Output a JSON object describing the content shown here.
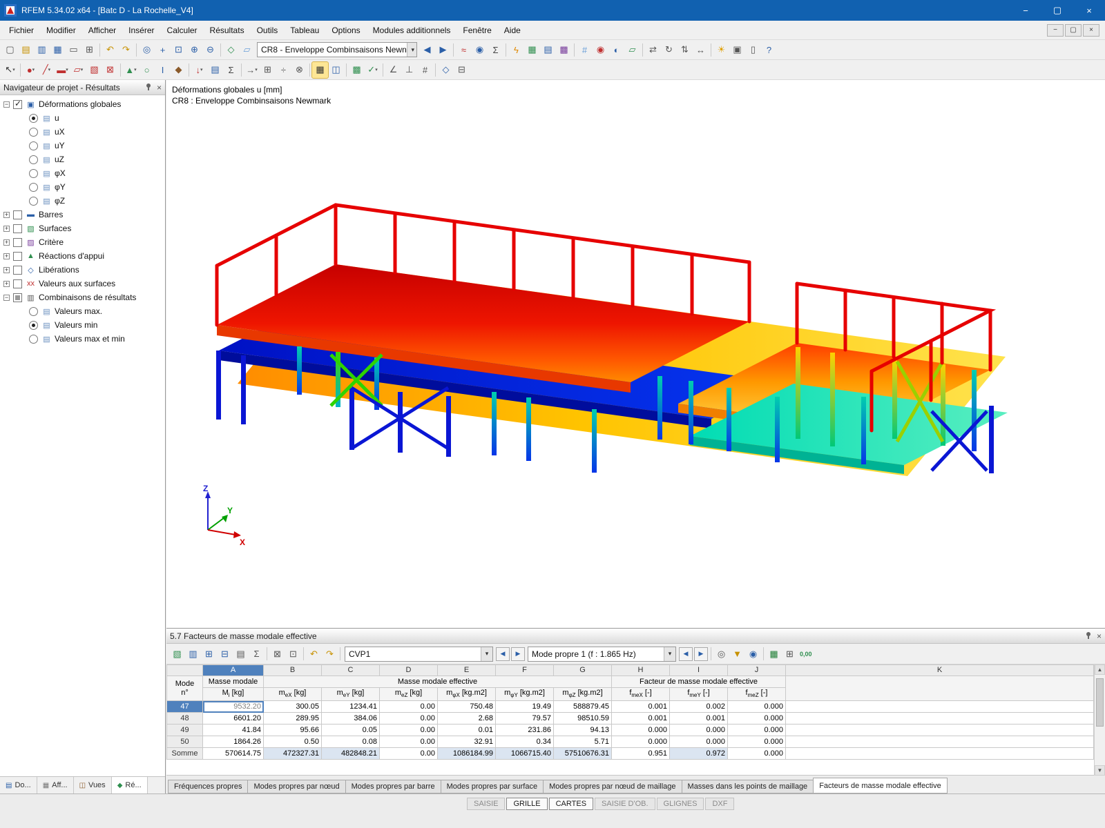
{
  "glyphs": {
    "chevron": "▾",
    "prev": "◀",
    "next": "▶",
    "close": "×"
  },
  "window": {
    "title": "RFEM 5.34.02 x64 - [Batc D - La Rochelle_V4]",
    "controls": {
      "minimize": "−",
      "maximize": "▢",
      "close": "×"
    },
    "mdi": {
      "minimize": "−",
      "restore": "▢",
      "close": "×"
    }
  },
  "menu": {
    "items": [
      "Fichier",
      "Modifier",
      "Afficher",
      "Insérer",
      "Calculer",
      "Résultats",
      "Outils",
      "Tableau",
      "Options",
      "Modules additionnels",
      "Fenêtre",
      "Aide"
    ]
  },
  "toolbars": {
    "case_combo": "CR8 - Enveloppe Combinsaisons Newn",
    "row1_left": [
      {
        "n": "new",
        "g": "▢",
        "c": "#555555"
      },
      {
        "n": "open",
        "g": "▤",
        "c": "#c79100"
      },
      {
        "n": "save",
        "g": "▥",
        "c": "#2b5fa8"
      },
      {
        "n": "save-all",
        "g": "▦",
        "c": "#2b5fa8"
      },
      {
        "n": "print",
        "g": "▭",
        "c": "#555555"
      },
      {
        "n": "copy",
        "g": "⊞",
        "c": "#555555"
      },
      {
        "sep": true
      },
      {
        "n": "undo",
        "g": "↶",
        "c": "#c79100"
      },
      {
        "n": "redo",
        "g": "↷",
        "c": "#c79100"
      },
      {
        "sep": true
      },
      {
        "n": "zoom",
        "g": "◎",
        "c": "#2b5fa8"
      },
      {
        "n": "pan",
        "g": "+",
        "c": "#2b5fa8"
      },
      {
        "n": "zoom-window",
        "g": "⊡",
        "c": "#2b5fa8"
      },
      {
        "n": "zoom-in",
        "g": "⊕",
        "c": "#2b5fa8"
      },
      {
        "n": "zoom-out",
        "g": "⊖",
        "c": "#2b5fa8"
      },
      {
        "sep": true
      },
      {
        "n": "isometric-view",
        "g": "◇",
        "c": "#2f8f4f"
      },
      {
        "n": "wireframe-view",
        "g": "▱",
        "c": "#6a9fd8"
      }
    ],
    "row1_right": [
      {
        "n": "previous-loadcase",
        "g": "◀",
        "c": "#2b5fa8"
      },
      {
        "n": "next-loadcase",
        "g": "▶",
        "c": "#2b5fa8"
      },
      {
        "sep": true
      },
      {
        "n": "show-results",
        "g": "≈",
        "c": "#c03030"
      },
      {
        "n": "result-values",
        "g": "◉",
        "c": "#2b5fa8"
      },
      {
        "n": "superpose-results",
        "g": "Σ",
        "c": "#444444"
      },
      {
        "sep": true
      },
      {
        "n": "calculation",
        "g": "ϟ",
        "c": "#e08900"
      },
      {
        "n": "fem-mesh",
        "g": "▦",
        "c": "#2f8f4f"
      },
      {
        "n": "tables",
        "g": "▤",
        "c": "#2b5fa8"
      },
      {
        "n": "modules",
        "g": "▩",
        "c": "#7a3f9d"
      },
      {
        "sep": true
      },
      {
        "n": "grid",
        "g": "#",
        "c": "#6a9fd8"
      },
      {
        "n": "snap",
        "g": "◉",
        "c": "#c03030"
      },
      {
        "n": "work-plane",
        "g": "◐",
        "c": "#2b5fa8"
      },
      {
        "n": "planes",
        "g": "▱",
        "c": "#2f8f4f"
      },
      {
        "sep": true
      },
      {
        "n": "move",
        "g": "⇄",
        "c": "#555555"
      },
      {
        "n": "rotate",
        "g": "↻",
        "c": "#555555"
      },
      {
        "n": "mirror",
        "g": "⇅",
        "c": "#555555"
      },
      {
        "n": "dimensions",
        "g": "↔",
        "c": "#555555"
      },
      {
        "sep": true
      },
      {
        "n": "render",
        "g": "☀",
        "c": "#e0a000"
      },
      {
        "n": "margins",
        "g": "▣",
        "c": "#555555"
      },
      {
        "n": "control-panel",
        "g": "▯",
        "c": "#555555"
      },
      {
        "n": "help",
        "g": "?",
        "c": "#2b5fa8"
      }
    ],
    "row2": [
      {
        "n": "select",
        "g": "↖",
        "c": "#333333",
        "dd": true
      },
      {
        "sep": true
      },
      {
        "n": "new-node",
        "g": "●",
        "c": "#c03030",
        "dd": true
      },
      {
        "n": "new-line",
        "g": "╱",
        "c": "#c03030",
        "dd": true
      },
      {
        "n": "new-member",
        "g": "▬",
        "c": "#c03030",
        "dd": true
      },
      {
        "n": "new-surface",
        "g": "▱",
        "c": "#c03030",
        "dd": true
      },
      {
        "n": "new-solid",
        "g": "▧",
        "c": "#c03030"
      },
      {
        "n": "new-opening",
        "g": "⊠",
        "c": "#c03030"
      },
      {
        "sep": true
      },
      {
        "n": "new-support",
        "g": "▲",
        "c": "#2f8f4f",
        "dd": true
      },
      {
        "n": "new-hinge",
        "g": "○",
        "c": "#2f8f4f"
      },
      {
        "n": "cross-section",
        "g": "I",
        "c": "#2b5fa8"
      },
      {
        "n": "material",
        "g": "◆",
        "c": "#8a5a2a"
      },
      {
        "sep": true
      },
      {
        "n": "new-load",
        "g": "↓",
        "c": "#c03030",
        "dd": true
      },
      {
        "n": "load-cases",
        "g": "▤",
        "c": "#2b5fa8"
      },
      {
        "n": "combinations",
        "g": "Σ",
        "c": "#444444"
      },
      {
        "sep": true
      },
      {
        "n": "edit-move",
        "g": "→",
        "c": "#555555",
        "dd": true
      },
      {
        "n": "edit-copy",
        "g": "⊞",
        "c": "#555555"
      },
      {
        "n": "edit-divide",
        "g": "÷",
        "c": "#555555"
      },
      {
        "n": "edit-connect",
        "g": "⊗",
        "c": "#555555"
      },
      {
        "sep": true
      },
      {
        "n": "display-properties",
        "g": "▦",
        "c": "#333333",
        "hl": true
      },
      {
        "n": "visibility",
        "g": "◫",
        "c": "#2b5fa8"
      },
      {
        "sep": true
      },
      {
        "n": "generate-mesh",
        "g": "▩",
        "c": "#2f8f4f"
      },
      {
        "n": "check",
        "g": "✓",
        "c": "#2f8f4f",
        "dd": true
      },
      {
        "sep": true
      },
      {
        "n": "measure",
        "g": "∠",
        "c": "#555555"
      },
      {
        "n": "coordinate-system",
        "g": "⊥",
        "c": "#555555"
      },
      {
        "n": "numbering",
        "g": "#",
        "c": "#555555"
      },
      {
        "sep": true
      },
      {
        "n": "views",
        "g": "◇",
        "c": "#2b5fa8"
      },
      {
        "n": "clipping",
        "g": "⊟",
        "c": "#555555"
      }
    ]
  },
  "navigator": {
    "title": "Navigateur de projet - Résultats",
    "tree": [
      {
        "level": 0,
        "expand": "minus",
        "check": "checked",
        "icon": "deformations-globales-icon",
        "icon_glyph": "▣",
        "icon_color": "#2b5fa8",
        "label": "Déformations globales"
      },
      {
        "level": 1,
        "radio": "selected",
        "icon": "result-u-icon",
        "icon_glyph": "▤",
        "icon_color": "#6a8fbf",
        "label": "u"
      },
      {
        "level": 1,
        "radio": "unselected",
        "icon": "result-ux-icon",
        "icon_glyph": "▤",
        "icon_color": "#6a8fbf",
        "label": "uX"
      },
      {
        "level": 1,
        "radio": "unselected",
        "icon": "result-uy-icon",
        "icon_glyph": "▤",
        "icon_color": "#6a8fbf",
        "label": "uY"
      },
      {
        "level": 1,
        "radio": "unselected",
        "icon": "result-uz-icon",
        "icon_glyph": "▤",
        "icon_color": "#6a8fbf",
        "label": "uZ"
      },
      {
        "level": 1,
        "radio": "unselected",
        "icon": "result-phix-icon",
        "icon_glyph": "▤",
        "icon_color": "#6a8fbf",
        "label": "φX"
      },
      {
        "level": 1,
        "radio": "unselected",
        "icon": "result-phiy-icon",
        "icon_glyph": "▤",
        "icon_color": "#6a8fbf",
        "label": "φY"
      },
      {
        "level": 1,
        "radio": "unselected",
        "icon": "result-phiz-icon",
        "icon_glyph": "▤",
        "icon_color": "#6a8fbf",
        "label": "φZ"
      },
      {
        "level": 0,
        "expand": "plus",
        "check": "unchecked",
        "icon": "barres-icon",
        "icon_glyph": "▬",
        "icon_color": "#2b5fa8",
        "label": "Barres"
      },
      {
        "level": 0,
        "expand": "plus",
        "check": "unchecked",
        "icon": "surfaces-icon",
        "icon_glyph": "▧",
        "icon_color": "#2f8f4f",
        "label": "Surfaces"
      },
      {
        "level": 0,
        "expand": "plus",
        "check": "unchecked",
        "icon": "critere-icon",
        "icon_glyph": "▨",
        "icon_color": "#7a3f9d",
        "label": "Critère"
      },
      {
        "level": 0,
        "expand": "plus",
        "check": "unchecked",
        "icon": "reactions-appui-icon",
        "icon_glyph": "▲",
        "icon_color": "#2f8f4f",
        "label": "Réactions d'appui"
      },
      {
        "level": 0,
        "expand": "plus",
        "check": "unchecked",
        "icon": "liberations-icon",
        "icon_glyph": "◇",
        "icon_color": "#2b5fa8",
        "label": "Libérations"
      },
      {
        "level": 0,
        "expand": "plus",
        "check": "unchecked",
        "icon": "valeurs-surfaces-icon",
        "icon_glyph": "xx",
        "icon_color": "#c03030",
        "label": "Valeurs aux surfaces"
      },
      {
        "level": 0,
        "expand": "minus",
        "check": "partial",
        "icon": "combinaisons-icon",
        "icon_glyph": "▥",
        "icon_color": "#555555",
        "label": "Combinaisons de résultats"
      },
      {
        "level": 1,
        "radio": "unselected",
        "icon": "valeurs-max-icon",
        "icon_glyph": "▤",
        "icon_color": "#6a8fbf",
        "label": "Valeurs max."
      },
      {
        "level": 1,
        "radio": "selected",
        "icon": "valeurs-min-icon",
        "icon_glyph": "▤",
        "icon_color": "#6a8fbf",
        "label": "Valeurs min"
      },
      {
        "level": 1,
        "radio": "unselected",
        "icon": "valeurs-max-min-icon",
        "icon_glyph": "▤",
        "icon_color": "#6a8fbf",
        "label": "Valeurs max et min"
      }
    ],
    "dock_tabs": [
      {
        "label": "Do...",
        "icon": "donnees-tab-icon",
        "glyph": "▤",
        "color": "#2b5fa8",
        "active": false
      },
      {
        "label": "Aff...",
        "icon": "affichage-tab-icon",
        "glyph": "▦",
        "color": "#777777",
        "active": false
      },
      {
        "label": "Vues",
        "icon": "vues-tab-icon",
        "glyph": "◫",
        "color": "#8a5a2a",
        "active": false
      },
      {
        "label": "Ré...",
        "icon": "resultats-tab-icon",
        "glyph": "◆",
        "color": "#2f8f4f",
        "active": true
      }
    ]
  },
  "viewport": {
    "label_line1": "Déformations globales u [mm]",
    "label_line2": "CR8 : Enveloppe Combinsaisons Newmark",
    "axis_x": "X",
    "axis_y": "Y",
    "axis_z": "Z"
  },
  "bottom_panel": {
    "title": "5.7 Facteurs de masse modale effective",
    "toolbar": {
      "combo_case": "CVP1",
      "combo_mode": "Mode propre 1 (f : 1.865 Hz)",
      "left_icons": [
        {
          "n": "color-scale",
          "g": "▧",
          "c": "#2f8f4f"
        },
        {
          "n": "table-filter",
          "g": "▥",
          "c": "#2b5fa8"
        },
        {
          "n": "insert-row",
          "g": "⊞",
          "c": "#2b5fa8"
        },
        {
          "n": "delete-row",
          "g": "⊟",
          "c": "#2b5fa8"
        },
        {
          "n": "result-rows",
          "g": "▤",
          "c": "#555555"
        },
        {
          "n": "sum-rows",
          "g": "Σ",
          "c": "#555555"
        },
        {
          "sep": true
        },
        {
          "n": "export-table",
          "g": "⊠",
          "c": "#555555"
        },
        {
          "n": "import-table",
          "g": "⊡",
          "c": "#555555"
        },
        {
          "sep": true
        },
        {
          "n": "undo-table",
          "g": "↶",
          "c": "#c79100"
        },
        {
          "n": "redo-table",
          "g": "↷",
          "c": "#c79100"
        },
        {
          "sep": true
        }
      ],
      "right_icons": [
        {
          "sep": true
        },
        {
          "n": "jump-to-mode",
          "g": "◎",
          "c": "#555555"
        },
        {
          "n": "filter",
          "g": "▼",
          "c": "#c79100"
        },
        {
          "n": "find",
          "g": "◉",
          "c": "#2b5fa8"
        },
        {
          "sep": true
        },
        {
          "n": "excel-export",
          "g": "▦",
          "c": "#1e7e34"
        },
        {
          "n": "calculator",
          "g": "⊞",
          "c": "#555555"
        },
        {
          "n": "decimal-places",
          "g": "0,00",
          "c": "#2f8f4f",
          "wide": true
        }
      ]
    },
    "table": {
      "letters": [
        "A",
        "B",
        "C",
        "D",
        "E",
        "F",
        "G",
        "H",
        "I",
        "J",
        "K"
      ],
      "selected_letter": "A",
      "row_header_top": "Mode",
      "row_header_bottom": "n°",
      "groups": [
        {
          "label": "Masse modale",
          "span": 1
        },
        {
          "label": "Masse modale effective",
          "span": 6
        },
        {
          "label": "Facteur de masse modale effective",
          "span": 3
        }
      ],
      "subheaders": [
        {
          "base": "M",
          "sub": "i",
          "unit": "[kg]"
        },
        {
          "base": "m",
          "sub": "eX",
          "unit": "[kg]"
        },
        {
          "base": "m",
          "sub": "eY",
          "unit": "[kg]"
        },
        {
          "base": "m",
          "sub": "eZ",
          "unit": "[kg]"
        },
        {
          "base": "m",
          "sub": "φX",
          "unit": "[kg.m2]"
        },
        {
          "base": "m",
          "sub": "φY",
          "unit": "[kg.m2]"
        },
        {
          "base": "m",
          "sub": "φZ",
          "unit": "[kg.m2]"
        },
        {
          "base": "f",
          "sub": "meX",
          "unit": "[-]"
        },
        {
          "base": "f",
          "sub": "meY",
          "unit": "[-]"
        },
        {
          "base": "f",
          "sub": "meZ",
          "unit": "[-]"
        }
      ],
      "rows": [
        {
          "mode": "47",
          "selected": true,
          "values": [
            "9532.20",
            "300.05",
            "1234.41",
            "0.00",
            "750.48",
            "19.49",
            "588879.45",
            "0.001",
            "0.002",
            "0.000"
          ]
        },
        {
          "mode": "48",
          "values": [
            "6601.20",
            "289.95",
            "384.06",
            "0.00",
            "2.68",
            "79.57",
            "98510.59",
            "0.001",
            "0.001",
            "0.000"
          ]
        },
        {
          "mode": "49",
          "values": [
            "41.84",
            "95.66",
            "0.05",
            "0.00",
            "0.01",
            "231.86",
            "94.13",
            "0.000",
            "0.000",
            "0.000"
          ]
        },
        {
          "mode": "50",
          "values": [
            "1864.26",
            "0.50",
            "0.08",
            "0.00",
            "32.91",
            "0.34",
            "5.71",
            "0.000",
            "0.000",
            "0.000"
          ]
        },
        {
          "mode": "Somme",
          "is_sum": true,
          "highlight_cols": [
            1,
            2,
            4,
            5,
            6,
            8
          ],
          "values": [
            "570614.75",
            "472327.31",
            "482848.21",
            "0.00",
            "1086184.99",
            "1066715.40",
            "57510676.31",
            "0.951",
            "0.972",
            "0.000"
          ]
        }
      ]
    },
    "tabs": [
      "Fréquences propres",
      "Modes propres par nœud",
      "Modes propres par barre",
      "Modes propres par surface",
      "Modes propres par nœud de maillage",
      "Masses dans les points de maillage",
      "Facteurs de masse modale effective"
    ],
    "active_tab": "Facteurs de masse modale effective"
  },
  "status_bar": {
    "items": [
      {
        "label": "SAISIE",
        "pressed": false
      },
      {
        "label": "GRILLE",
        "pressed": true
      },
      {
        "label": "CARTES",
        "pressed": true
      },
      {
        "label": "SAISIE D'OB.",
        "pressed": false
      },
      {
        "label": "GLIGNES",
        "pressed": false
      },
      {
        "label": "DXF",
        "pressed": false
      }
    ]
  }
}
